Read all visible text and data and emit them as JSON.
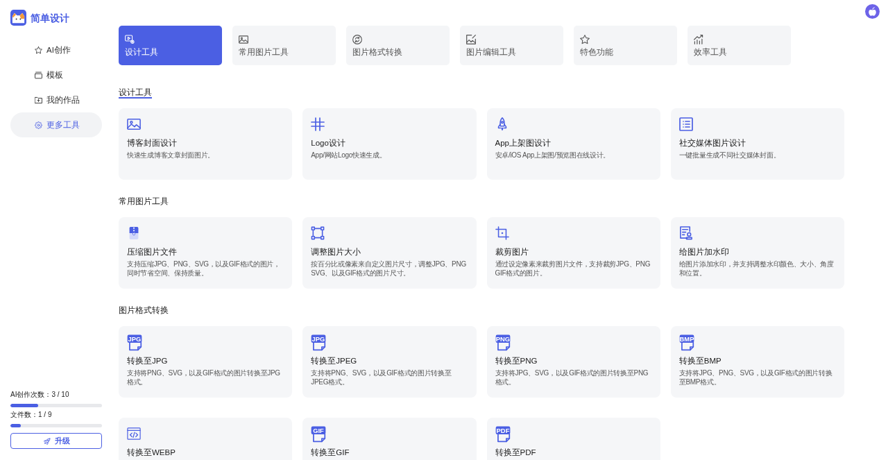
{
  "brand": {
    "name": "简单设计"
  },
  "nav": [
    {
      "label": "AI创作",
      "selected": false
    },
    {
      "label": "模板",
      "selected": false
    },
    {
      "label": "我的作品",
      "selected": false
    },
    {
      "label": "更多工具",
      "selected": true
    }
  ],
  "usage": [
    {
      "label": "AI创作次数：3 / 10",
      "level": 0.3
    },
    {
      "label": "文件数：1 / 9",
      "level": 0.11
    }
  ],
  "upgrade_button": {
    "label": "升级"
  },
  "tabs": [
    {
      "label": "设计工具",
      "selected": true
    },
    {
      "label": "常用图片工具",
      "selected": false
    },
    {
      "label": "图片格式转换",
      "selected": false
    },
    {
      "label": "图片编辑工具",
      "selected": false
    },
    {
      "label": "特色功能",
      "selected": false
    },
    {
      "label": "效率工具",
      "selected": false
    }
  ],
  "sections": [
    {
      "title": "设计工具",
      "current": true,
      "cards": [
        {
          "title": "博客封面设计",
          "description": "快速生成博客文章封面图片。"
        },
        {
          "title": "Logo设计",
          "description": "App/网站Logo快速生成。"
        },
        {
          "title": "App上架图设计",
          "description": "安卓/iOS App上架图/预览图在线设计。"
        },
        {
          "title": "社交媒体图片设计",
          "description": "一键批量生成不同社交媒体封面。"
        }
      ]
    },
    {
      "title": "常用图片工具",
      "current": false,
      "cards": [
        {
          "title": "压缩图片文件",
          "description": "支持压缩JPG、PNG、SVG，以及GIF格式的图片，同时节省空间、保持质量。"
        },
        {
          "title": "调整图片大小",
          "description": "按百分比或像素来自定义图片尺寸，调整JPG、PNG SVG、以及GIF格式的图片尺寸。"
        },
        {
          "title": "裁剪图片",
          "description": "通过设定像素来裁剪图片文件，支持裁剪JPG、PNG GIF格式的图片。"
        },
        {
          "title": "给图片加水印",
          "description": "给图片添加水印，并支持调整水印颜色、大小、角度和位置。"
        }
      ]
    },
    {
      "title": "图片格式转换",
      "current": false,
      "cards": [
        {
          "title": "转换至JPG",
          "icon_text": "JPG",
          "description": "支持将PNG、SVG，以及GIF格式的图片转换至JPG格式。"
        },
        {
          "title": "转换至JPEG",
          "icon_text": "JPG",
          "description": "支持将PNG、SVG，以及GIF格式的图片转换至JPEG格式。"
        },
        {
          "title": "转换至PNG",
          "icon_text": "PNG",
          "description": "支持将JPG、SVG，以及GIF格式的图片转换至PNG格式。"
        },
        {
          "title": "转换至BMP",
          "icon_text": "BMP",
          "description": "支持将JPG、PNG、SVG，以及GIF格式的图片转换至BMP格式。"
        },
        {
          "title": "转换至WEBP"
        },
        {
          "title": "转换至GIF",
          "icon_text": "GIF"
        },
        {
          "title": "转换至PDF",
          "icon_text": "PDF"
        }
      ]
    }
  ]
}
